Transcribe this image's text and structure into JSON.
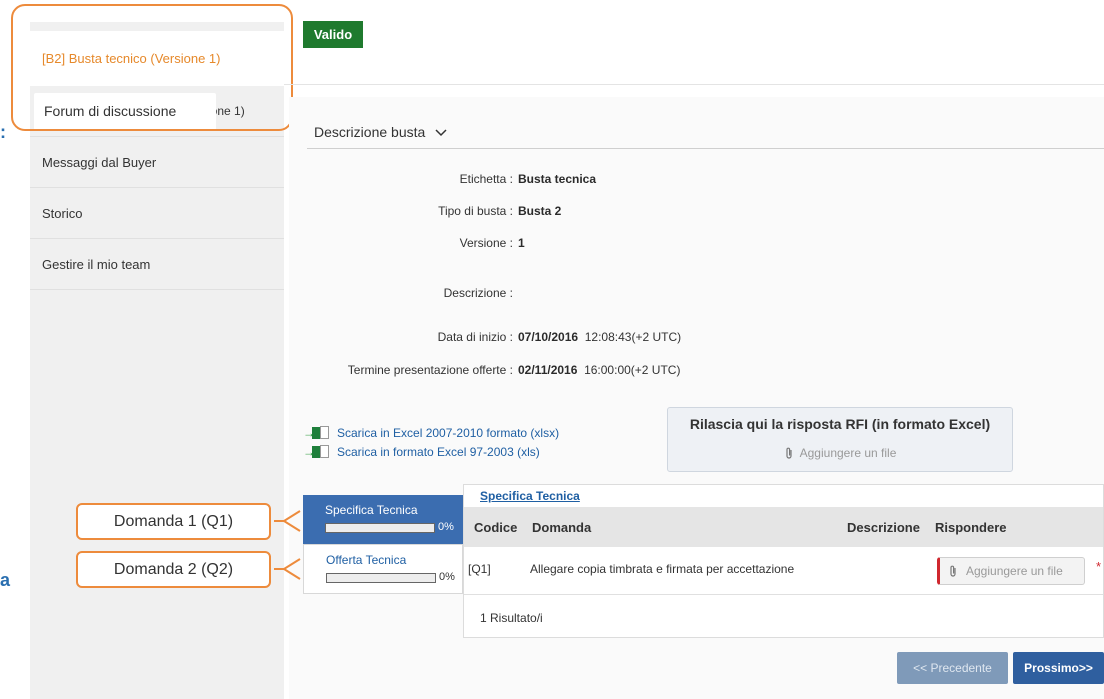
{
  "sidebar": {
    "items": [
      {
        "label": "[B2] Busta tecnico (Versione 1)"
      },
      {
        "label": "Forum di discussione"
      },
      {
        "label": "Messaggi dal Buyer"
      },
      {
        "label": "Storico"
      },
      {
        "label": "Gestire il mio team"
      }
    ],
    "partial_label": "ione 1)"
  },
  "edge_fragments": {
    "colon": ":",
    "letter": "a"
  },
  "status_badge": "Valido",
  "description": {
    "header": "Descrizione busta",
    "fields": [
      {
        "label": "Etichetta :",
        "value": "Busta tecnica",
        "extra": ""
      },
      {
        "label": "Tipo di busta :",
        "value": "Busta 2",
        "extra": ""
      },
      {
        "label": "Versione :",
        "value": "1",
        "extra": ""
      },
      {
        "label": "Descrizione :",
        "value": "",
        "extra": ""
      },
      {
        "label": "Data di inizio :",
        "value": "07/10/2016",
        "extra": "12:08:43(+2 UTC)"
      },
      {
        "label": "Termine presentazione offerte :",
        "value": "02/11/2016",
        "extra": "16:00:00(+2 UTC)"
      }
    ]
  },
  "downloads": [
    {
      "label": "Scarica in Excel 2007-2010 formato (xlsx)"
    },
    {
      "label": "Scarica in formato Excel 97-2003 (xls)"
    }
  ],
  "rfi": {
    "title": "Rilascia qui la risposta RFI (in formato Excel)",
    "add_file": "Aggiungere un file"
  },
  "question_tabs": [
    {
      "name": "Specifica Tecnica",
      "progress": 0,
      "progress_label": "0%"
    },
    {
      "name": "Offerta Tecnica",
      "progress": 0,
      "progress_label": "0%"
    }
  ],
  "question_panel": {
    "title": "Specifica Tecnica",
    "columns": [
      "Codice",
      "Domanda",
      "Descrizione",
      "Rispondere"
    ],
    "rows": [
      {
        "code": "[Q1]",
        "question": "Allegare copia timbrata e firmata per accettazione",
        "attach": "Aggiungere un file",
        "required": "*"
      }
    ],
    "footer": "1 Risultato/i"
  },
  "pager": {
    "prev": "<< Precedente",
    "next": "Prossimo>>"
  },
  "callouts": [
    {
      "label": "Domanda 1 (Q1)"
    },
    {
      "label": "Domanda 2 (Q2)"
    }
  ],
  "colors": {
    "accent_orange": "#ed8b3c",
    "primary_blue": "#3b6db0",
    "valid_green": "#1f7a2e",
    "required_red": "#d0282f"
  }
}
